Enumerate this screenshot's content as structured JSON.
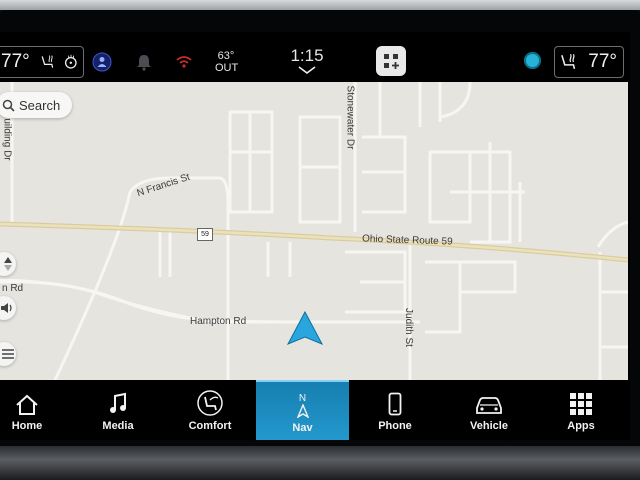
{
  "status_bar": {
    "driver_temp": "77°",
    "passenger_temp": "77°",
    "outside_temp": "63°",
    "outside_label": "OUT",
    "time": "1:15"
  },
  "map": {
    "search_label": "Search",
    "roads": {
      "route59": "Ohio State Route 59",
      "hampton": "Hampton Rd",
      "francis": "N Francis St",
      "stonewater": "Stonewater Dr",
      "judith": "Judith St",
      "building": "uilding Dr",
      "n_rd": "n Rd",
      "shield": "59"
    }
  },
  "nav_bar": {
    "home": "Home",
    "media": "Media",
    "comfort": "Comfort",
    "nav": "Nav",
    "nav_compass": "N",
    "phone": "Phone",
    "vehicle": "Vehicle",
    "apps": "Apps"
  },
  "colors": {
    "accent": "#1b8fc4",
    "map_bg": "#e6e4df",
    "route_color": "#e2d6a8",
    "vehicle_arrow": "#29a6dd"
  }
}
